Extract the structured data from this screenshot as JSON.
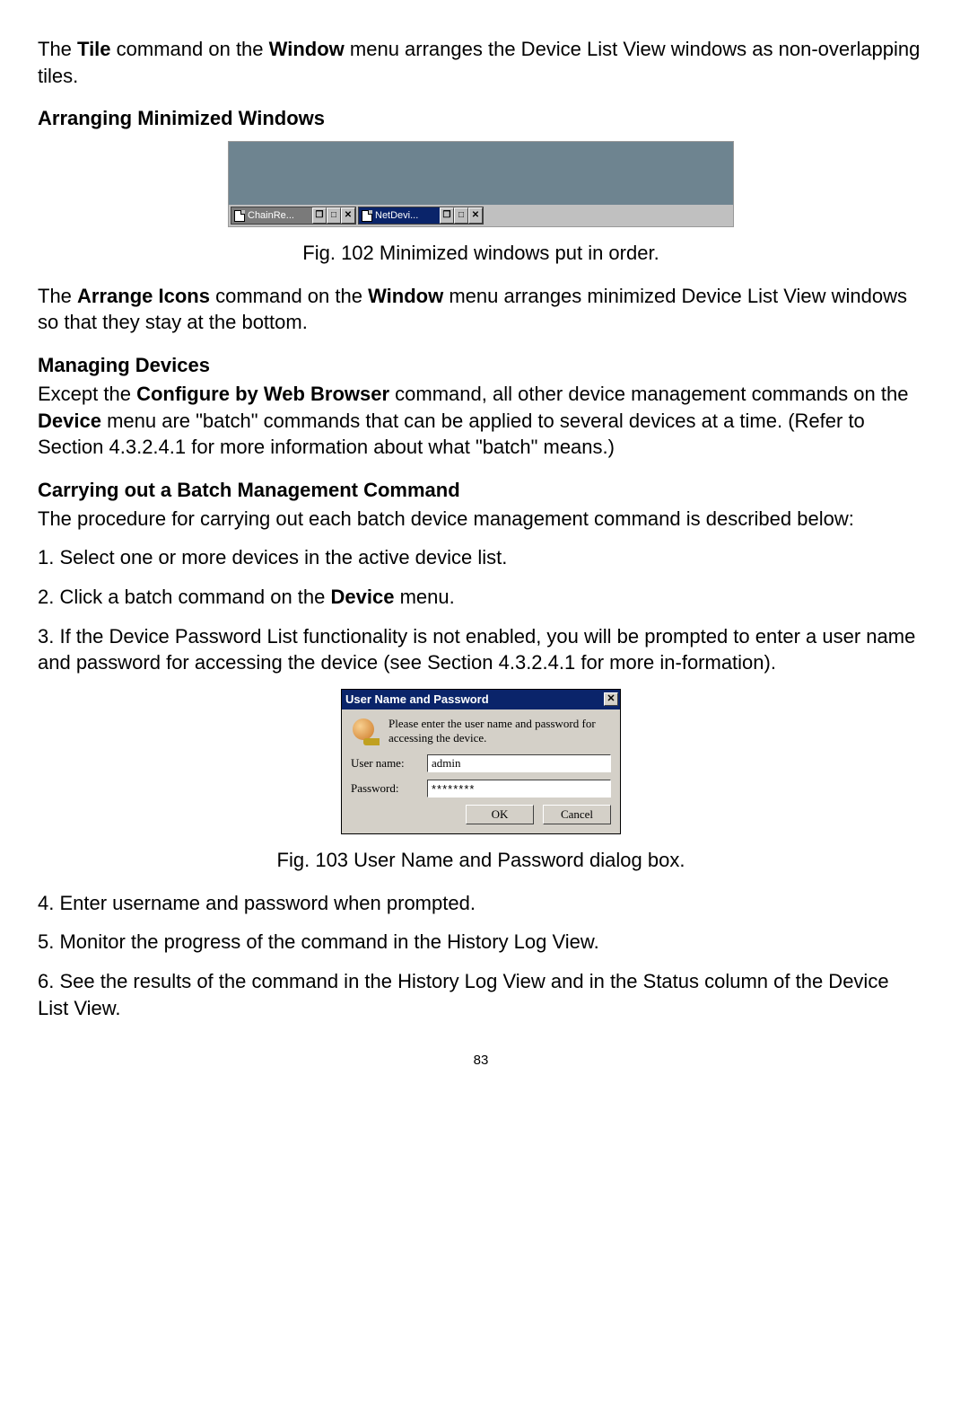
{
  "intro": {
    "pre1": "The ",
    "b1": "Tile",
    "mid1": " command on the ",
    "b2": "Window",
    "post1": " menu arranges the Device List View windows as non-overlapping tiles."
  },
  "heading1": "Arranging Minimized Windows",
  "fig102": {
    "win1": "ChainRe...",
    "win2": "NetDevi...",
    "caption": "Fig. 102 Minimized windows put in order."
  },
  "arrange": {
    "pre": "The ",
    "b1": "Arrange Icons",
    "mid": " command on the ",
    "b2": "Window",
    "post": " menu arranges minimized Device List View windows so that they stay at the bottom."
  },
  "heading2": "Managing Devices",
  "managing": {
    "pre": "Except the ",
    "b1": "Configure by Web Browser",
    "mid1": " command, all other device management commands on the ",
    "b2": "Device",
    "post": " menu are \"batch\" commands that can be applied to several devices at a time. (Refer to Section 4.3.2.4.1 for more information about what \"batch\" means.)"
  },
  "heading3": "Carrying out a Batch Management Command",
  "carry_intro": "The procedure for carrying out each batch device management command is described below:",
  "steps": {
    "s1": "1. Select one or more devices in the active device list.",
    "s2_pre": "2. Click a batch command on the ",
    "s2_b": "Device",
    "s2_post": " menu.",
    "s3": "3. If the Device Password List functionality is not enabled, you will be prompted to enter a user name and password for accessing the device (see Section 4.3.2.4.1 for more in-formation).",
    "s4": "4. Enter username and password when prompted.",
    "s5": "5. Monitor the progress of the command in the History Log View.",
    "s6": "6. See the results of the command in the History Log View and in the Status column of the Device List View."
  },
  "fig103": {
    "title": "User Name and Password",
    "msg": "Please enter the user name and password for accessing the device.",
    "user_label": "User name:",
    "pass_label": "Password:",
    "user_value": "admin",
    "pass_value": "********",
    "ok": "OK",
    "cancel": "Cancel",
    "caption": "Fig. 103 User Name and Password dialog box."
  },
  "page_number": "83"
}
